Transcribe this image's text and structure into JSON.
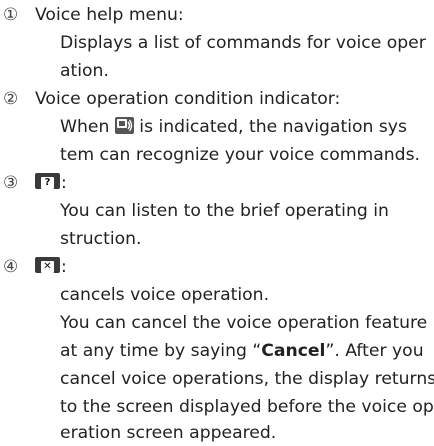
{
  "items": [
    {
      "number": "①",
      "title": "Voice help menu:",
      "body": [
        "Displays a list of commands for voice oper",
        "ation."
      ]
    },
    {
      "number": "②",
      "title": "Voice operation condition indicator:",
      "body_line1_before": "When ",
      "body_line1_after": " is indicated, the navigation sys",
      "body": [
        "tem can recognize your voice commands."
      ]
    },
    {
      "number": "③",
      "button_symbol": "?",
      "colon": ":",
      "body": [
        "You can listen to the brief operating in",
        "struction."
      ]
    },
    {
      "number": "④",
      "button_symbol": "✕",
      "colon": ":",
      "body_short": "cancels voice operation.",
      "para_1_before": "You can cancel the voice operation feature",
      "para_2_before": "at any time by saying “",
      "cancel_word": "Cancel",
      "para_2_after": "”. After you",
      "para_3": "cancel voice operations, the display returns",
      "para_4": "to the screen displayed before the voice op",
      "para_5": "eration screen appeared."
    }
  ],
  "icons": {
    "voice_indicator": "microphone-speech-icon",
    "help_button": "question-button-icon",
    "cancel_button": "cancel-x-button-icon"
  }
}
